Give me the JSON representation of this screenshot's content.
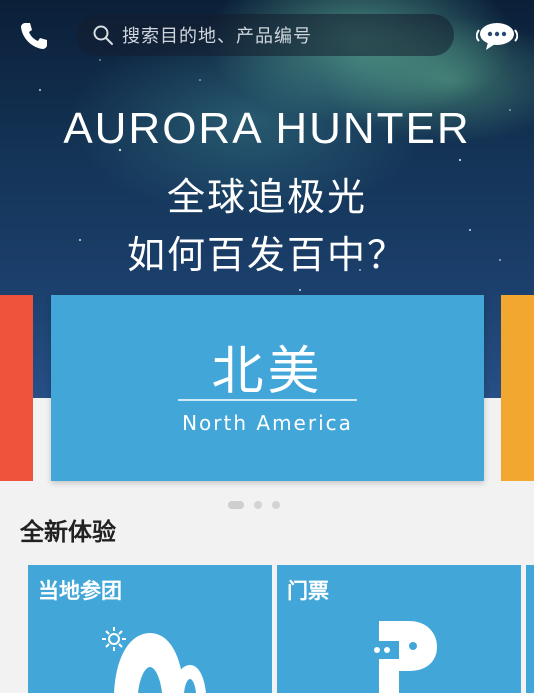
{
  "topbar": {
    "phone_icon": "phone-icon",
    "search_placeholder": "搜索目的地、产品编号",
    "chat_icon": "chat-bubble-icon"
  },
  "banner": {
    "title": "AURORA HUNTER",
    "line1": "全球追极光",
    "line2": "如何百发百中？"
  },
  "carousel": {
    "active_card": {
      "title_zh": "北美",
      "title_en": "North America",
      "color": "#42a7d8"
    },
    "left_card_color": "#ef533b",
    "right_card_color": "#f2a730",
    "dots_total": 3,
    "dots_active": 0
  },
  "section": {
    "title": "全新体验",
    "tiles": [
      {
        "label": "当地参团",
        "icon": "tent-sun-icon"
      },
      {
        "label": "门票",
        "icon": "ticket-p-icon"
      }
    ]
  }
}
